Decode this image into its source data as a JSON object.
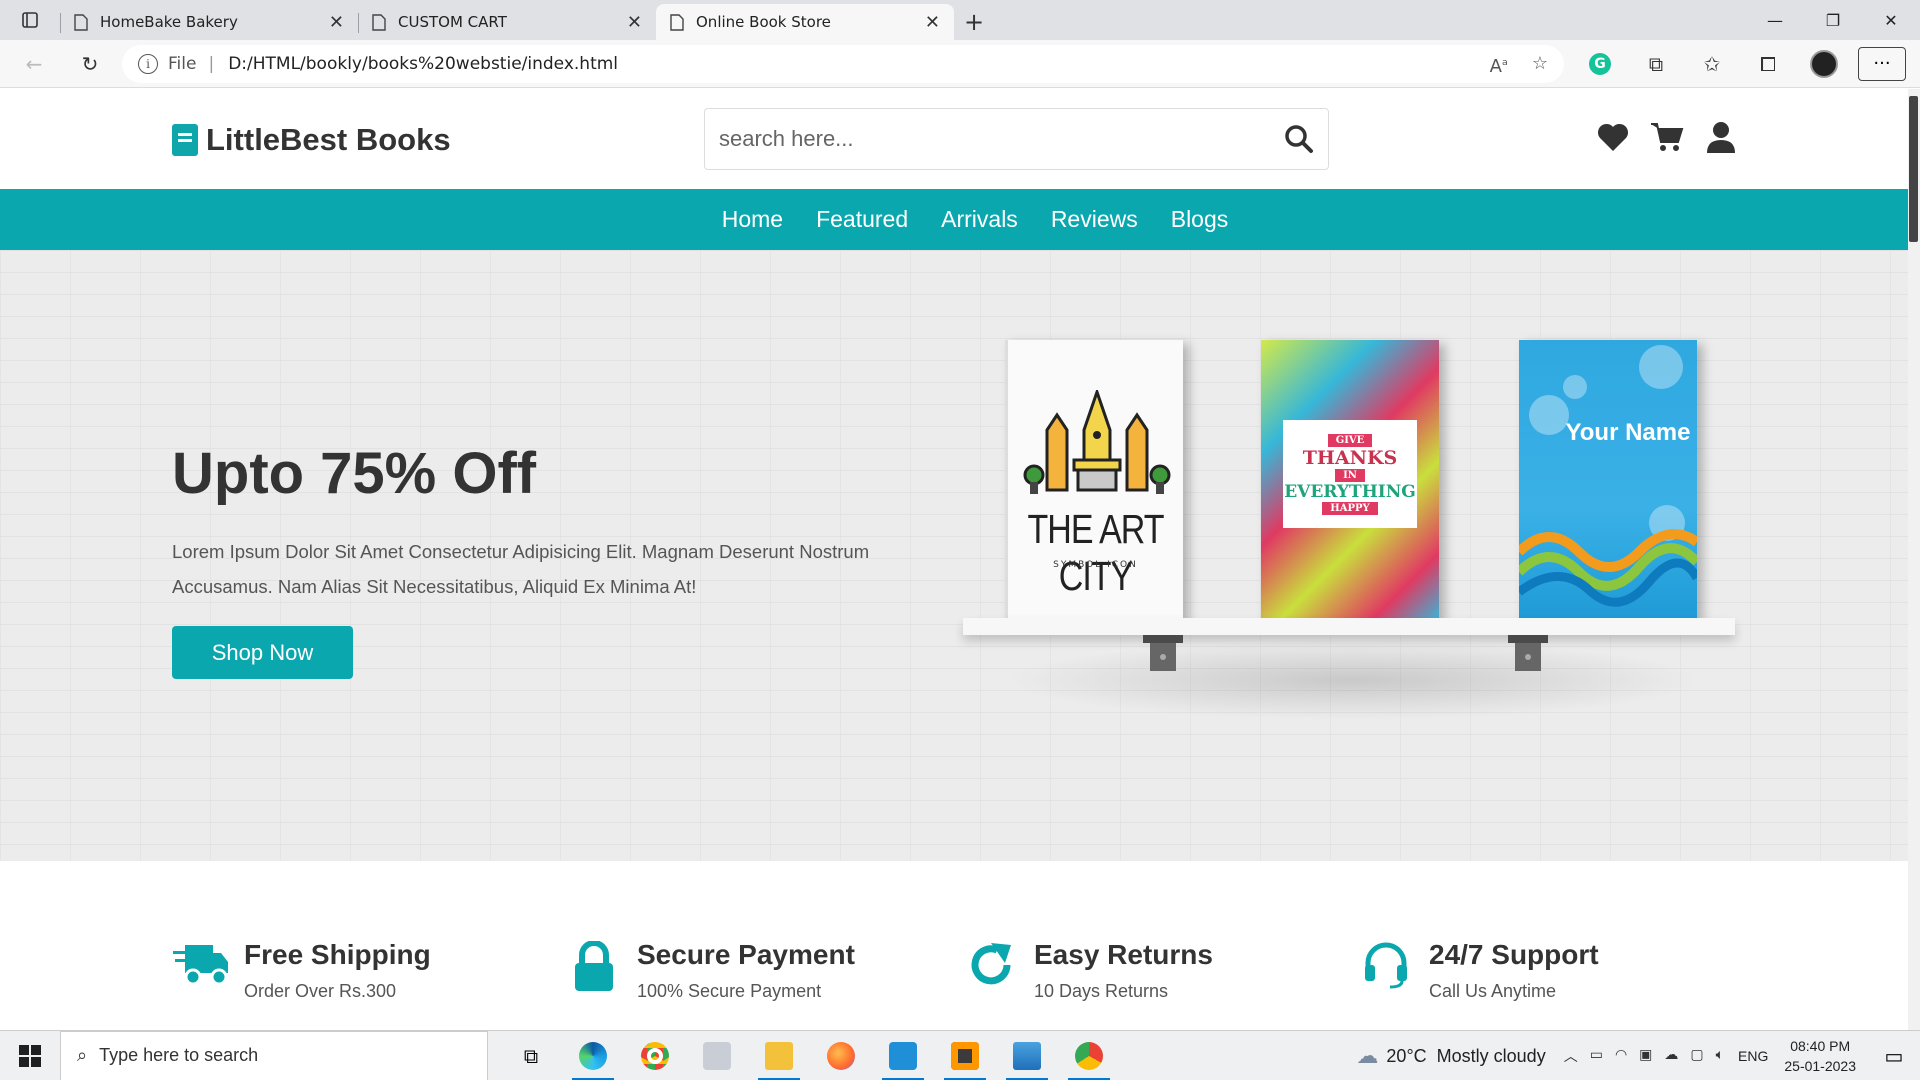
{
  "browser": {
    "tabs": [
      {
        "title": "HomeBake Bakery"
      },
      {
        "title": "CUSTOM CART"
      },
      {
        "title": "Online Book Store"
      }
    ],
    "address": {
      "scheme_label": "File",
      "url": "D:/HTML/bookly/books%20webstie/index.html"
    }
  },
  "site": {
    "logo_text": "LittleBest Books",
    "search_placeholder": "search here...",
    "nav": [
      "Home",
      "Featured",
      "Arrivals",
      "Reviews",
      "Blogs"
    ],
    "hero": {
      "title": "Upto 75% Off",
      "text": "Lorem Ipsum Dolor Sit Amet Consectetur Adipisicing Elit. Magnam Deserunt Nostrum Accusamus. Nam Alias Sit Necessitatibus, Aliquid Ex Minima At!",
      "button": "Shop Now"
    },
    "books": {
      "art_city_title": "THE ART CITY",
      "art_city_sub": "SYMBOL ICON",
      "thanks_give": "GIVE",
      "thanks_main": "THANKS",
      "thanks_in": "IN",
      "thanks_everything": "EVERYTHING",
      "thanks_happy": "HAPPY",
      "your_name": "Your Name"
    },
    "features": [
      {
        "title": "Free Shipping",
        "sub": "Order Over Rs.300",
        "icon": "truck-icon"
      },
      {
        "title": "Secure Payment",
        "sub": "100% Secure Payment",
        "icon": "lock-icon"
      },
      {
        "title": "Easy Returns",
        "sub": "10 Days Returns",
        "icon": "redo-icon"
      },
      {
        "title": "24/7 Support",
        "sub": "Call Us Anytime",
        "icon": "headset-icon"
      }
    ],
    "colors": {
      "accent": "#0aa7af",
      "text": "#333333"
    }
  },
  "taskbar": {
    "search_placeholder": "Type here to search",
    "weather_temp": "20°C",
    "weather_text": "Mostly cloudy",
    "language": "ENG",
    "time": "08:40 PM",
    "date": "25-01-2023"
  }
}
